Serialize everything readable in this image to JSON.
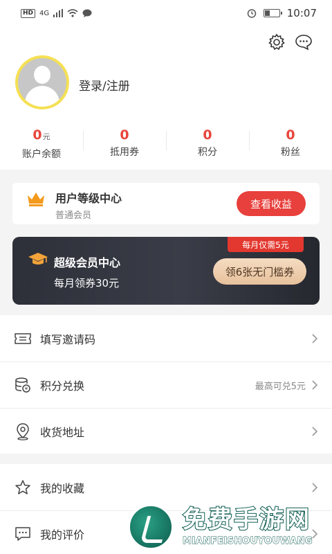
{
  "status_bar": {
    "left_badge": "HD",
    "signal_label": "4G",
    "time": "10:07"
  },
  "header": {
    "settings_icon": "gear-icon",
    "message_icon": "chat-bubble-icon",
    "login_text": "登录/注册"
  },
  "stats": [
    {
      "value": "0",
      "unit": "元",
      "label": "账户余额"
    },
    {
      "value": "0",
      "unit": "",
      "label": "抵用券"
    },
    {
      "value": "0",
      "unit": "",
      "label": "积分"
    },
    {
      "value": "0",
      "unit": "",
      "label": "粉丝"
    }
  ],
  "level_card": {
    "title": "用户等级中心",
    "subtitle": "普通会员",
    "button": "查看收益"
  },
  "vip_card": {
    "title": "超级会员中心",
    "subtitle": "每月领券30元",
    "tag": "每月仅需5元",
    "button": "领6张无门槛券"
  },
  "menu_a": [
    {
      "label": "填写邀请码",
      "hint": "",
      "icon": "ticket-icon"
    },
    {
      "label": "积分兑换",
      "hint": "最高可兑5元",
      "icon": "coins-icon"
    },
    {
      "label": "收货地址",
      "hint": "",
      "icon": "location-pin-icon"
    }
  ],
  "menu_b": [
    {
      "label": "我的收藏",
      "hint": "",
      "icon": "star-icon"
    },
    {
      "label": "我的评价",
      "hint": "",
      "icon": "comment-icon"
    }
  ],
  "watermark": {
    "title": "免费手游网",
    "subtitle": "MIANFEISHOUYOUWANG"
  },
  "colors": {
    "accent_red": "#e8403c",
    "avatar_ring": "#f5e053",
    "vip_dark": "#2d3039",
    "vip_gold": "#e7c19c"
  }
}
